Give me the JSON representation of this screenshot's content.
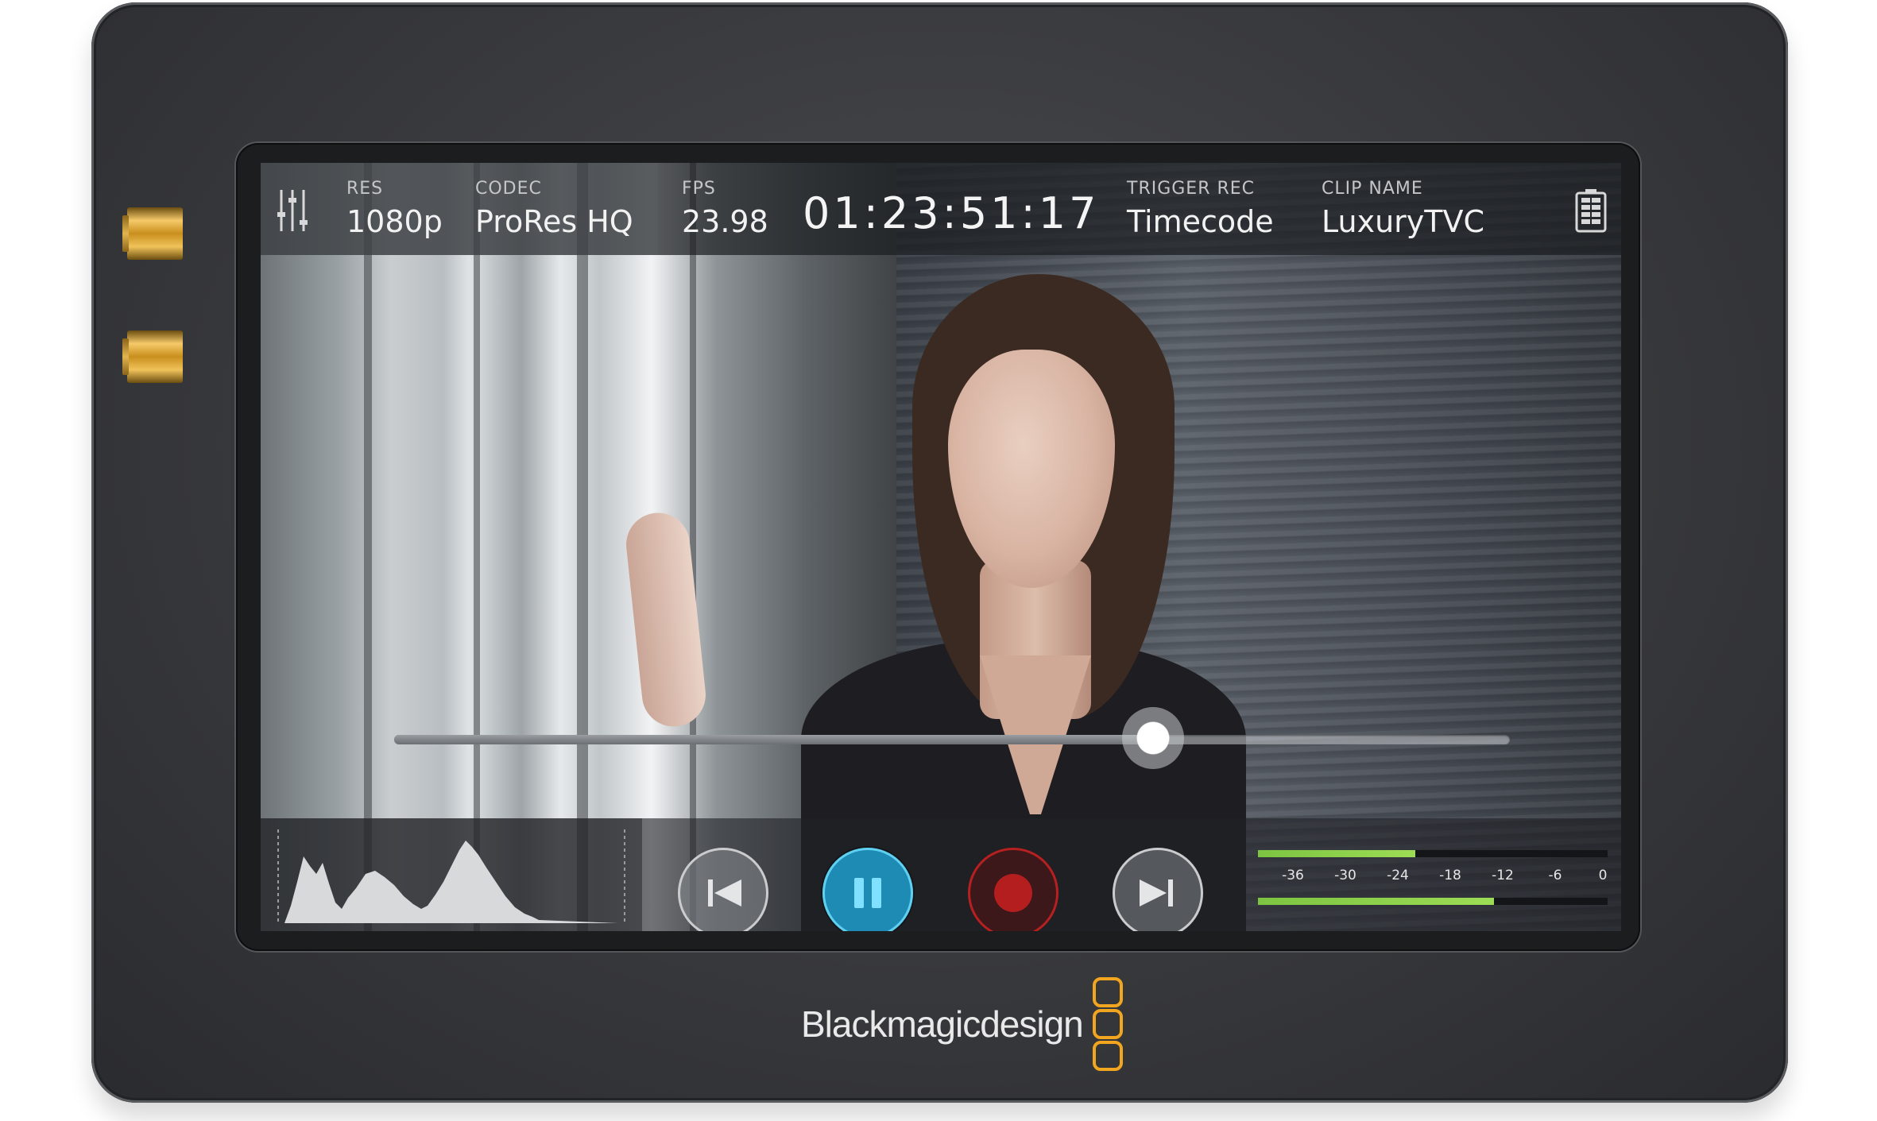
{
  "device": {
    "brand": "Blackmagicdesign",
    "accent_color": "#f2a51f"
  },
  "topbar": {
    "settings_icon": "sliders-icon",
    "res": {
      "label": "RES",
      "value": "1080p"
    },
    "codec": {
      "label": "CODEC",
      "value": "ProRes HQ"
    },
    "fps": {
      "label": "FPS",
      "value": "23.98"
    },
    "timecode": "01:23:51:17",
    "trigger": {
      "label": "TRIGGER REC",
      "value": "Timecode"
    },
    "clip": {
      "label": "CLIP NAME",
      "value": "LuxuryTVC"
    },
    "storage_icon": "battery-icon"
  },
  "playback": {
    "position": 0.68,
    "controls": [
      {
        "name": "skip-previous-icon",
        "color": "#c9cbcd"
      },
      {
        "name": "pause-icon",
        "color": "#5fd0f0"
      },
      {
        "name": "record-icon",
        "color": "#b62020"
      },
      {
        "name": "skip-next-icon",
        "color": "#c9cbcd"
      }
    ]
  },
  "audio_meters": {
    "ticks": [
      "-36",
      "-30",
      "-24",
      "-18",
      "-12",
      "-6",
      "0"
    ],
    "tick_values": [
      -36,
      -30,
      -24,
      -18,
      -12,
      -6,
      0
    ],
    "channel_levels_db": [
      -22,
      -13
    ],
    "meter_color": "#8bd04b"
  }
}
